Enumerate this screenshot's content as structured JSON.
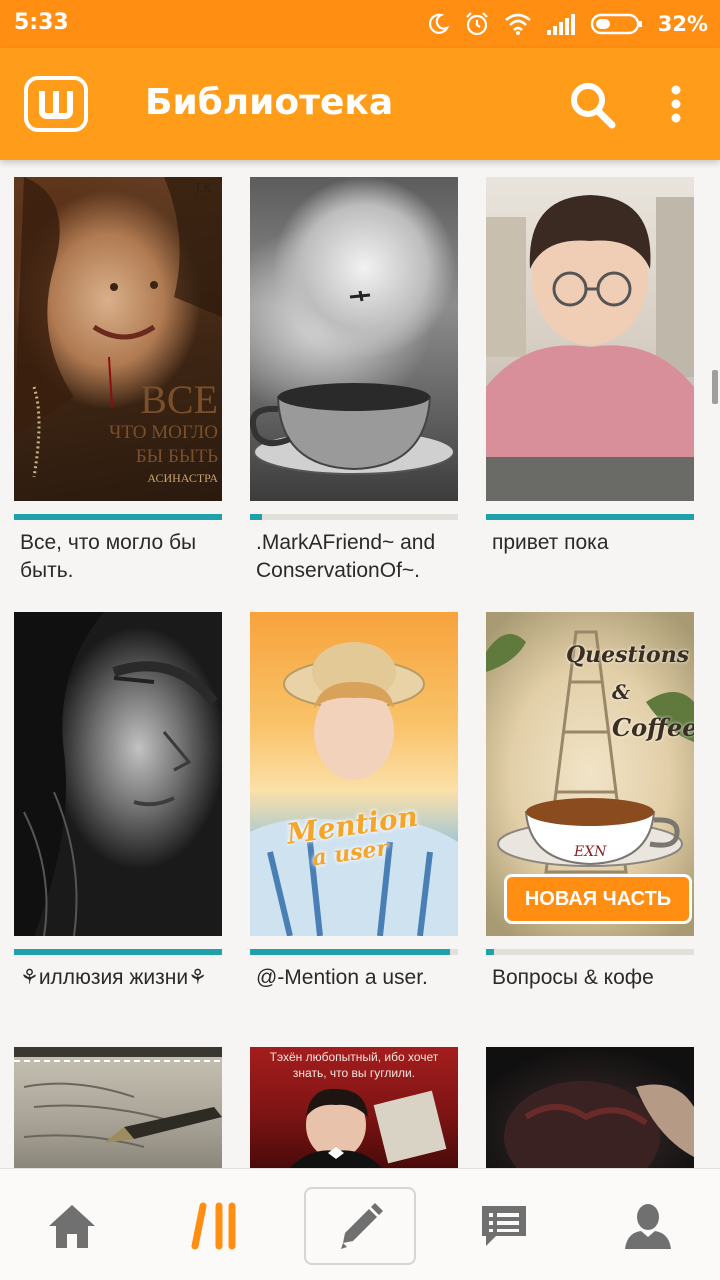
{
  "status_bar": {
    "time": "5:33",
    "battery_percent": "32%",
    "battery_level": 0.32,
    "icons": [
      "moon-icon",
      "alarm-icon",
      "wifi-icon",
      "signal-icon",
      "battery-icon"
    ]
  },
  "app_bar": {
    "title": "Библиотека",
    "logo_icon": "wattpad-logo-icon",
    "search_icon": "search-icon",
    "menu_icon": "more-vertical-icon",
    "color": "#ff9c1a"
  },
  "books": [
    {
      "title": "Все, что могло бы быть.",
      "progress": 1.0,
      "cover_text": [
        "ВСЕ",
        "ЧТО МОГЛО",
        "БЫ БЫТЬ",
        "АСИНАСТРА"
      ],
      "cover_signature": "J.K"
    },
    {
      "title": ".MarkAFriend~ and ConservationOf~.",
      "progress": 0.06,
      "cover_text": []
    },
    {
      "title": "привет пока",
      "progress": 1.0,
      "cover_text": []
    },
    {
      "title": "⚘иллюзия жизни⚘",
      "progress": 1.0,
      "cover_text": []
    },
    {
      "title": "@-Mention a user.",
      "progress": 0.96,
      "cover_text": [
        "Mention",
        "a user"
      ]
    },
    {
      "title": "Вопросы & кофе",
      "progress": 0.04,
      "cover_text": [
        "Questions",
        "&",
        "Coffee",
        "EXN"
      ],
      "badge": "НОВАЯ ЧАСТЬ"
    },
    {
      "title": "",
      "progress": null,
      "cover_text": []
    },
    {
      "title": "",
      "progress": null,
      "cover_text": [
        "Тэхён любопытный, ибо хочет",
        "знать, что вы гуглили."
      ]
    },
    {
      "title": "",
      "progress": null,
      "cover_text": []
    }
  ],
  "bottom_nav": {
    "items": [
      "home-icon",
      "library-icon",
      "write-icon",
      "messages-icon",
      "profile-icon"
    ],
    "active": "library-icon",
    "accent": "#ff8e13"
  },
  "colors": {
    "accent": "#ff9c1a",
    "progress": "#1ea1a8",
    "background": "#f7f5f3"
  }
}
